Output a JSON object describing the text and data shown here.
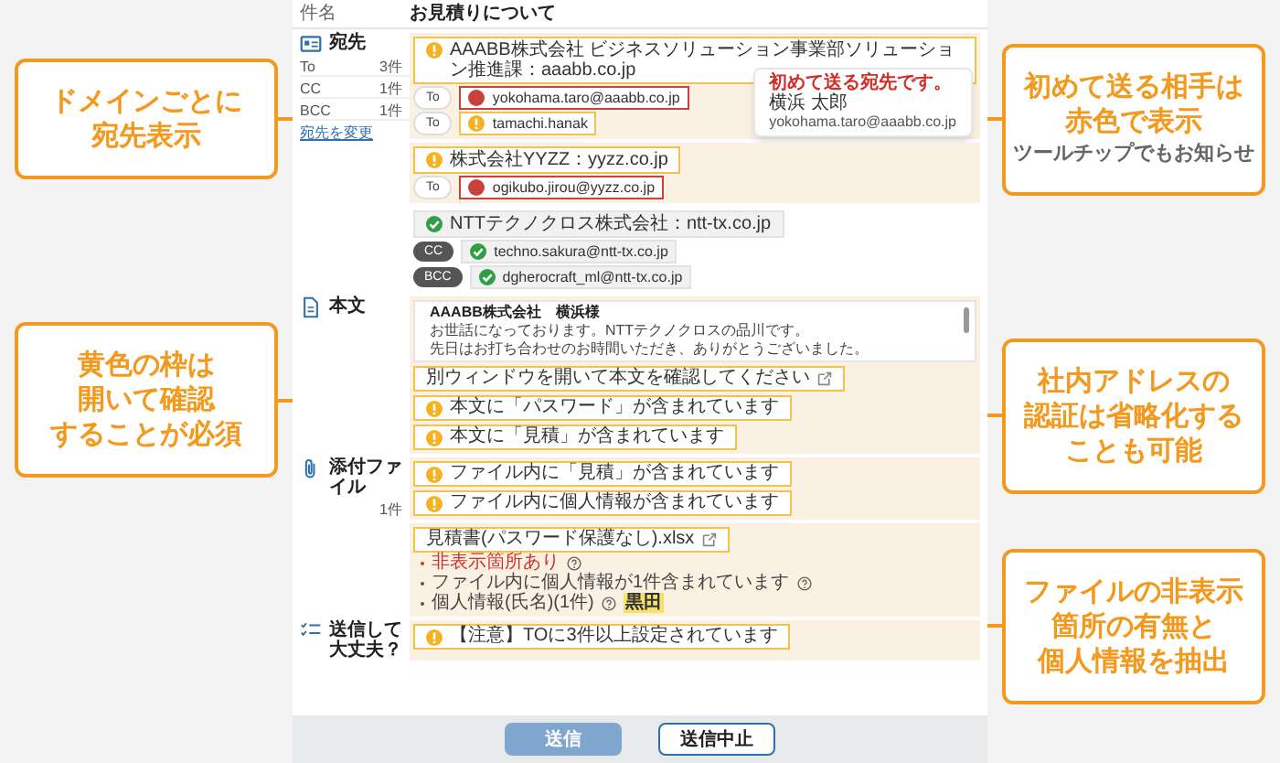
{
  "subject": {
    "label": "件名",
    "value": "お見積りについて"
  },
  "recipients": {
    "label": "宛先",
    "counts": [
      {
        "label": "To",
        "value": "3件"
      },
      {
        "label": "CC",
        "value": "1件"
      },
      {
        "label": "BCC",
        "value": "1件"
      }
    ],
    "change_link": "宛先を変更",
    "groups": [
      {
        "kind": "warning",
        "domain": "AAABB株式会社 ビジネスソリューション事業部ソリューション推進課：aaabb.co.jp",
        "addresses": [
          {
            "field": "To",
            "address": "yokohama.taro@aaabb.co.jp",
            "kind": "new"
          },
          {
            "field": "To",
            "address": "tamachi.hanak",
            "kind": "warning"
          }
        ]
      },
      {
        "kind": "warning",
        "domain": "株式会社YYZZ：yyzz.co.jp",
        "addresses": [
          {
            "field": "To",
            "address": "ogikubo.jirou@yyzz.co.jp",
            "kind": "new"
          }
        ]
      },
      {
        "kind": "verified",
        "domain": "NTTテクノクロス株式会社：ntt-tx.co.jp",
        "addresses": [
          {
            "field": "CC",
            "address": "techno.sakura@ntt-tx.co.jp",
            "kind": "verified"
          },
          {
            "field": "BCC",
            "address": "dgherocraft_ml@ntt-tx.co.jp",
            "kind": "verified"
          }
        ]
      }
    ],
    "tooltip": {
      "title": "初めて送る宛先です。",
      "name": "横浜 太郎",
      "address": "yokohama.taro@aaabb.co.jp"
    }
  },
  "body": {
    "label": "本文",
    "preview": [
      "AAABB株式会社　横浜様",
      "お世話になっております。NTTテクノクロスの品川です。",
      "先日はお打ち合わせのお時間いただき、ありがとうございました。"
    ],
    "notices": [
      {
        "kind": "link",
        "text": "別ウィンドウを開いて本文を確認してください"
      },
      {
        "kind": "warning",
        "text": "本文に「パスワード」が含まれています"
      },
      {
        "kind": "warning",
        "text": "本文に「見積」が含まれています"
      }
    ]
  },
  "attachments": {
    "label": "添付ファイル",
    "count": "1件",
    "notices": [
      {
        "kind": "warning",
        "text": "ファイル内に「見積」が含まれています"
      },
      {
        "kind": "warning",
        "text": "ファイル内に個人情報が含まれています"
      }
    ],
    "file": {
      "name": "見積書(パスワード保護なし).xlsx",
      "checks": [
        {
          "kind": "alert",
          "text": "非表示箇所あり"
        },
        {
          "kind": "info",
          "text": "ファイル内に個人情報が1件含まれています"
        },
        {
          "kind": "info",
          "text": "個人情報(氏名)(1件)",
          "highlight": "黒田"
        }
      ]
    }
  },
  "final_check": {
    "label": "送信して大丈夫？",
    "notices": [
      {
        "kind": "warning",
        "text": "【注意】TOに3件以上設定されています"
      }
    ]
  },
  "buttons": [
    {
      "label": "送信",
      "disabled": true
    },
    {
      "label": "送信中止",
      "disabled": false
    }
  ],
  "callouts_left": [
    {
      "lines": [
        "ドメインごとに",
        "宛先表示"
      ]
    },
    {
      "lines": [
        "黄色の枠は",
        "開いて確認",
        "することが必須"
      ]
    }
  ],
  "callouts_right": [
    {
      "lines": [
        "初めて送る相手は",
        "赤色で表示"
      ],
      "note": "ツールチップでもお知らせ"
    },
    {
      "lines": [
        "社内アドレスの",
        "認証は省略化する",
        "ことも可能"
      ]
    },
    {
      "lines": [
        "ファイルの非表示",
        "箇所の有無と",
        "個人情報を抽出"
      ]
    }
  ]
}
